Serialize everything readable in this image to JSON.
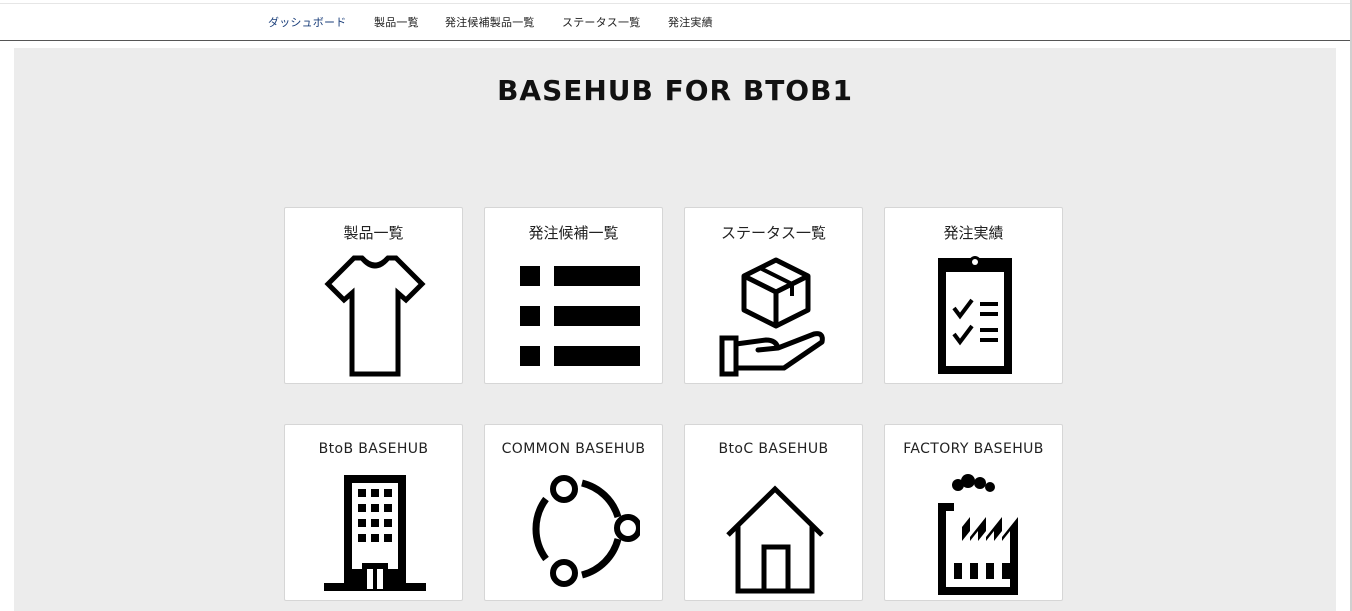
{
  "nav": {
    "items": [
      {
        "label": "ダッシュボード",
        "active": true
      },
      {
        "label": "製品一覧"
      },
      {
        "label": "発注候補製品一覧"
      },
      {
        "label": "ステータス一覧"
      },
      {
        "label": "発注実績"
      }
    ]
  },
  "page": {
    "title": "BASEHUB FOR BTOB1"
  },
  "cards_row1": [
    {
      "label": "製品一覧",
      "icon": "t-shirt-icon"
    },
    {
      "label": "発注候補一覧",
      "icon": "list-icon"
    },
    {
      "label": "ステータス一覧",
      "icon": "box-in-hand-icon"
    },
    {
      "label": "発注実績",
      "icon": "clipboard-checklist-icon"
    }
  ],
  "cards_row2": [
    {
      "label": "BtoB BASEHUB",
      "icon": "office-building-icon"
    },
    {
      "label": "COMMON BASEHUB",
      "icon": "connected-circle-icon"
    },
    {
      "label": "BtoC BASEHUB",
      "icon": "house-icon"
    },
    {
      "label": "FACTORY BASEHUB",
      "icon": "factory-icon"
    }
  ],
  "colors": {
    "nav_active": "#1a3e7a",
    "background": "#ececec",
    "card": "#ffffff"
  }
}
